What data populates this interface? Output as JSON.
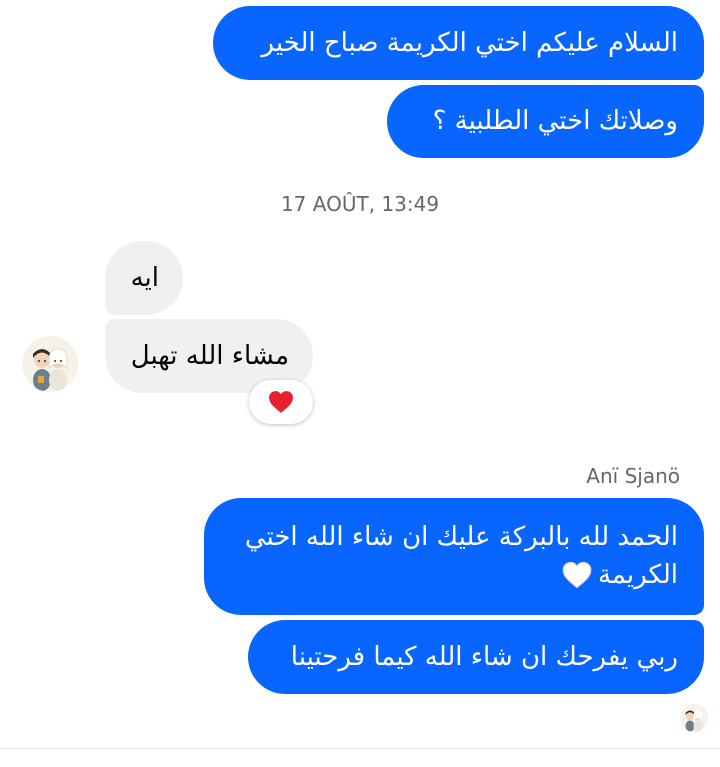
{
  "messages": {
    "out1": "السلام عليكم اختي الكريمة صباح الخير",
    "out2": "وصلاتك اختي الطلبية ؟",
    "in1": "ايه",
    "in2": "مشاء الله تهبل",
    "out3_line1": "الحمد لله بالبركة عليك ان شاء الله اختي",
    "out3_line2": "الكريمة",
    "out4": "ربي يفرحك ان شاء الله كيما فرحتينا"
  },
  "timestamp": "17 AOÛT, 13:49",
  "sender_name": "Anï Sjanö",
  "icons": {
    "reaction": "red-heart-icon",
    "inline_emoji": "white-heart-icon",
    "contact_avatar": "contact-avatar",
    "read_receipt": "read-receipt-avatar"
  },
  "colors": {
    "outgoing_bubble": "#0866ff",
    "incoming_bubble": "#f0f0f3",
    "reaction_heart": "#e8202f"
  }
}
